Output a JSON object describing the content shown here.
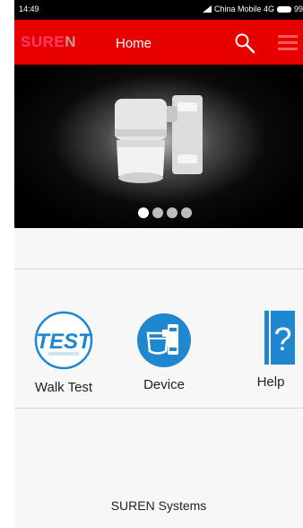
{
  "status_bar": {
    "time": "14:49",
    "carrier": "China Mobile 4G",
    "battery": "99"
  },
  "app_bar": {
    "brand_head": "SURE",
    "brand_tail": "N",
    "title": "Home",
    "color": "#e80000"
  },
  "banner": {
    "slide_count": 4,
    "active_slide": 1
  },
  "features": {
    "walk_test": {
      "icon_text": "TEST",
      "label": "Walk Test"
    },
    "device": {
      "label": "Device"
    },
    "help": {
      "icon_text": "?",
      "label": "Help"
    }
  },
  "footer": {
    "text": "SUREN Systems"
  },
  "icons": [
    "signal-icon",
    "battery-icon",
    "search-icon",
    "menu-icon",
    "camera-image",
    "test-icon",
    "device-icon",
    "help-icon"
  ]
}
